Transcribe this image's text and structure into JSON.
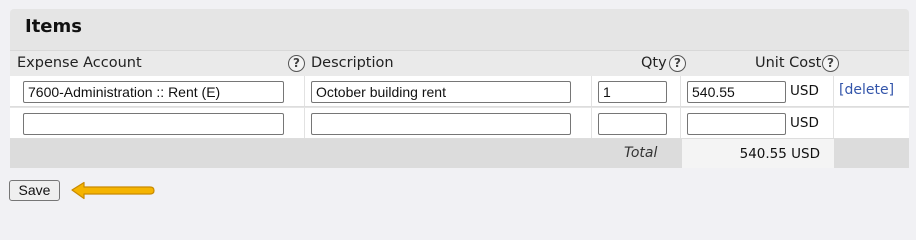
{
  "panel": {
    "title": "Items"
  },
  "columns": {
    "expense_account": "Expense Account",
    "description": "Description",
    "qty": "Qty",
    "unit_cost": "Unit Cost",
    "help_glyph": "?"
  },
  "rows": [
    {
      "account": "7600-Administration :: Rent (E)",
      "description": "October building rent",
      "qty": "1",
      "unit_cost": "540.55",
      "currency": "USD",
      "delete_label": "[delete]"
    },
    {
      "account": "",
      "description": "",
      "qty": "",
      "unit_cost": "",
      "currency": "USD"
    }
  ],
  "total": {
    "label": "Total",
    "value": "540.55 USD"
  },
  "actions": {
    "save_label": "Save"
  },
  "colors": {
    "panel_bg": "#e5e5e5",
    "link": "#3355aa",
    "arrow": "#f5b400"
  },
  "icons": {
    "help": "question-circle-icon",
    "pointer": "arrow-left-icon"
  }
}
